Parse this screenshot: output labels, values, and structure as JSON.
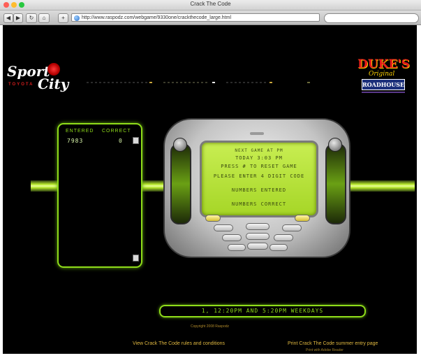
{
  "window": {
    "title": "Crack The Code",
    "traffic_colors": [
      "#ff5f57",
      "#febc2e",
      "#28c840"
    ]
  },
  "toolbar": {
    "back": "◀",
    "forward": "▶",
    "reload": "↻",
    "home": "⌂",
    "add": "+",
    "address": "http://www.raspodz.com/webgame/9330one/crackthecode_large.html"
  },
  "logos": {
    "left_sport": "Sport",
    "left_city": "City",
    "left_toyota": "TOYOTA",
    "right_dukes": "DUKE'S",
    "right_original": "Original",
    "right_roadhouse": "ROADHOUSE"
  },
  "panel": {
    "entered_header": "ENTERED",
    "correct_header": "CORRECT",
    "entered_value": "7983",
    "correct_value": "0"
  },
  "screen": {
    "line1": "NEXT GAME AT PM",
    "line2": "TODAY 3:03 PM",
    "line3": "PRESS # TO RESET GAME",
    "line4": "PLEASE ENTER 4 DIGIT CODE",
    "line5": "NUMBERS ENTERED",
    "line6": "NUMBERS CORRECT"
  },
  "footer": {
    "hours": "1, 12:20PM AND 5:20PM WEEKDAYS",
    "copyright": "Copyright 2008 Raspodz",
    "rules_link": "View Crack The Code rules and conditions",
    "print_link": "Print Crack The Code summer entry page",
    "print_sub": "Print with Adobe Reader"
  }
}
